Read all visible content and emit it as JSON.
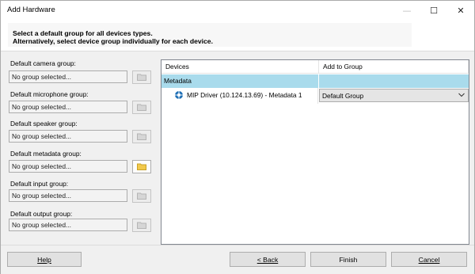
{
  "window": {
    "title": "Add Hardware"
  },
  "controls": {
    "minimize": "—",
    "maximize": "☐",
    "close": "✕"
  },
  "header": {
    "line1": "Select a default group for all devices types.",
    "line2": "Alternatively, select device group individually for each device."
  },
  "groups": [
    {
      "label": "Default camera group:",
      "value": "No group selected...",
      "folder_enabled": false
    },
    {
      "label": "Default microphone group:",
      "value": "No group selected...",
      "folder_enabled": false
    },
    {
      "label": "Default speaker group:",
      "value": "No group selected...",
      "folder_enabled": false
    },
    {
      "label": "Default metadata group:",
      "value": "No group selected...",
      "folder_enabled": true
    },
    {
      "label": "Default input group:",
      "value": "No group selected...",
      "folder_enabled": false
    },
    {
      "label": "Default output group:",
      "value": "No group selected...",
      "folder_enabled": false
    }
  ],
  "grid": {
    "col_devices": "Devices",
    "col_add_to_group": "Add to Group",
    "group_row": {
      "name": "Metadata"
    },
    "device": {
      "name": "MIP Driver (10.124.13.69) - Metadata 1",
      "group": "Default Group",
      "icon": "metadata-device-icon"
    }
  },
  "footer": {
    "help": "Help",
    "back": "< Back",
    "finish": "Finish",
    "cancel": "Cancel"
  },
  "colors": {
    "selected_row": "#a9dbec",
    "folder_enabled": "#f2c94c",
    "folder_disabled": "#cfcfcf"
  }
}
